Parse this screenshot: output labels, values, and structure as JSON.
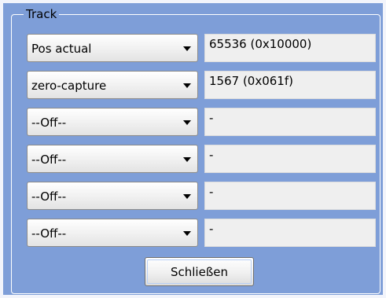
{
  "group": {
    "title": "Track"
  },
  "rows": [
    {
      "selected": "Pos actual",
      "value": "65536 (0x10000)"
    },
    {
      "selected": "zero-capture",
      "value": "1567 (0x061f)"
    },
    {
      "selected": "--Off--",
      "value": "-"
    },
    {
      "selected": "--Off--",
      "value": "-"
    },
    {
      "selected": "--Off--",
      "value": "-"
    },
    {
      "selected": "--Off--",
      "value": "-"
    }
  ],
  "buttons": {
    "close_label": "Schließen"
  },
  "colors": {
    "panel_background": "#7e9ed8",
    "value_background": "#efefef"
  },
  "icons": {
    "dropdown": "chevron-down-icon"
  }
}
